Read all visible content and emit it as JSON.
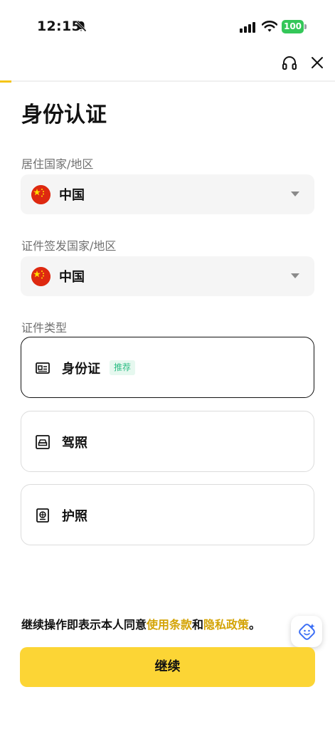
{
  "status_bar": {
    "time": "12:15",
    "battery": "100"
  },
  "page": {
    "title": "身份认证"
  },
  "residence": {
    "label": "居住国家/地区",
    "value": "中国"
  },
  "issuing": {
    "label": "证件签发国家/地区",
    "value": "中国"
  },
  "doc_type": {
    "label": "证件类型",
    "options": [
      {
        "label": "身份证",
        "badge": "推荐",
        "icon": "id-card-icon"
      },
      {
        "label": "驾照",
        "icon": "driver-license-icon"
      },
      {
        "label": "护照",
        "icon": "passport-icon"
      }
    ]
  },
  "terms": {
    "prefix": "继续操作即表示本人同意",
    "terms_link": "使用条款",
    "conj": "和",
    "privacy_link": "隐私政策",
    "suffix": "。"
  },
  "continue_button": "继续",
  "colors": {
    "accent": "#fcd535",
    "link": "#d4a406",
    "badge_text": "#2ebd85"
  }
}
